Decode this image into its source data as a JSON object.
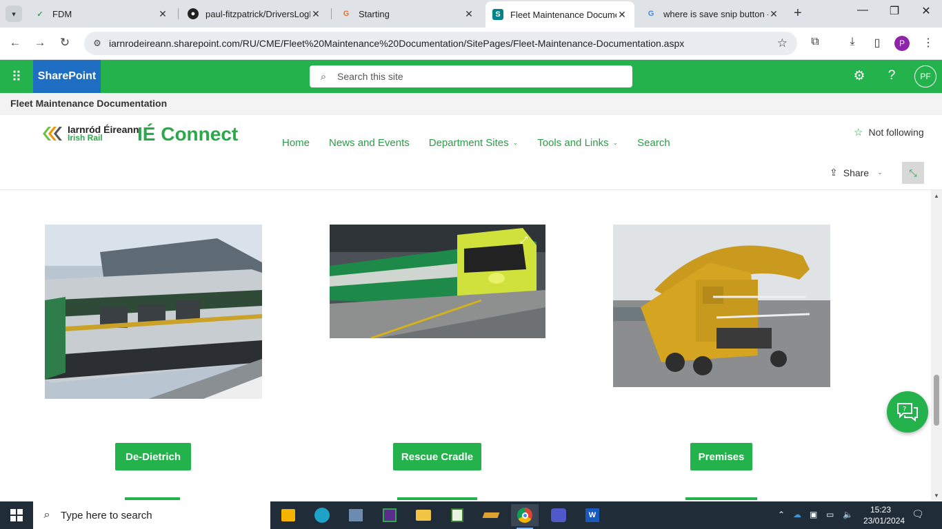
{
  "browser": {
    "tabs": [
      {
        "label": "FDM",
        "icon": "fdm-icon"
      },
      {
        "label": "paul-fitzpatrick/DriversLogBo",
        "icon": "github-icon"
      },
      {
        "label": "Starting",
        "icon": "g-orange-icon"
      },
      {
        "label": "Fleet Maintenance Documen",
        "icon": "sharepoint-icon"
      },
      {
        "label": "where is save snip button - G",
        "icon": "google-icon"
      }
    ],
    "url": "iarnrodeireann.sharepoint.com/RU/CME/Fleet%20Maintenance%20Documentation/SitePages/Fleet-Maintenance-Documentation.aspx",
    "profile_initial": "P"
  },
  "suitebar": {
    "brand": "SharePoint",
    "search_placeholder": "Search this site",
    "avatar_initials": "PF"
  },
  "hub": {
    "title": "Fleet Maintenance Documentation"
  },
  "site": {
    "logo_line1": "Iarnród Éireann",
    "logo_line2": "Irish Rail",
    "title": "IÉ Connect",
    "nav": [
      {
        "label": "Home",
        "has_dropdown": false
      },
      {
        "label": "News and Events",
        "has_dropdown": false
      },
      {
        "label": "Department Sites",
        "has_dropdown": true
      },
      {
        "label": "Tools and Links",
        "has_dropdown": true
      },
      {
        "label": "Search",
        "has_dropdown": false
      }
    ],
    "follow_label": "Not following",
    "share_label": "Share"
  },
  "cards": [
    {
      "button": "De-Dietrich",
      "image": "De-Dietrich rail coach"
    },
    {
      "button": "Rescue Cradle",
      "image": "Intercity train at platform"
    },
    {
      "button": "Premises",
      "image": "Yellow ballast wagon"
    }
  ],
  "taskbar": {
    "search_placeholder": "Type here to search",
    "time": "15:23",
    "date": "23/01/2024"
  },
  "colors": {
    "accent": "#23b24b",
    "brand_blue": "#1e6fc4"
  }
}
